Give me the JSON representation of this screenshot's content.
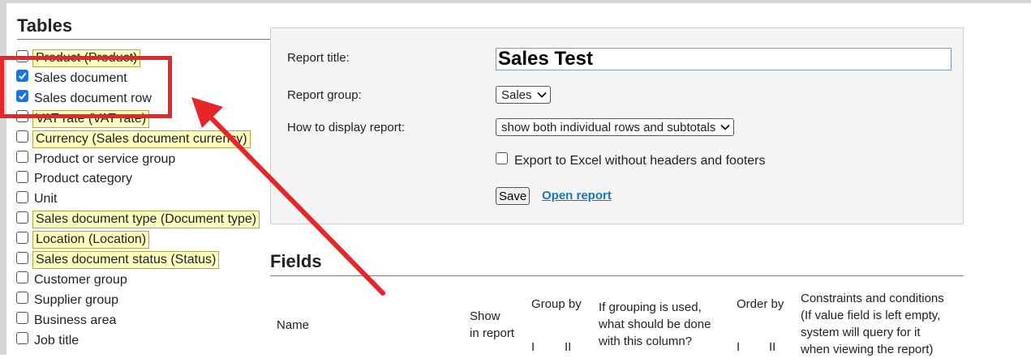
{
  "tables": {
    "heading": "Tables",
    "items": [
      {
        "label": "Product (Product)",
        "checked": false,
        "highlighted": true
      },
      {
        "label": "Sales document",
        "checked": true,
        "highlighted": false
      },
      {
        "label": "Sales document row",
        "checked": true,
        "highlighted": false
      },
      {
        "label": "VAT rate (VAT rate)",
        "checked": false,
        "highlighted": true
      },
      {
        "label": "Currency (Sales document currency)",
        "checked": false,
        "highlighted": true
      },
      {
        "label": "Product or service group",
        "checked": false,
        "highlighted": false
      },
      {
        "label": "Product category",
        "checked": false,
        "highlighted": false
      },
      {
        "label": "Unit",
        "checked": false,
        "highlighted": false
      },
      {
        "label": "Sales document type (Document type)",
        "checked": false,
        "highlighted": true
      },
      {
        "label": "Location (Location)",
        "checked": false,
        "highlighted": true
      },
      {
        "label": "Sales document status (Status)",
        "checked": false,
        "highlighted": true
      },
      {
        "label": "Customer group",
        "checked": false,
        "highlighted": false
      },
      {
        "label": "Supplier group",
        "checked": false,
        "highlighted": false
      },
      {
        "label": "Business area",
        "checked": false,
        "highlighted": false
      },
      {
        "label": "Job title",
        "checked": false,
        "highlighted": false
      }
    ]
  },
  "form": {
    "report_title_label": "Report title:",
    "report_title_value": "Sales Test",
    "report_group_label": "Report group:",
    "report_group_value": "Sales",
    "display_label": "How to display report:",
    "display_value": "show both individual rows and subtotals",
    "export_label": "Export to Excel without headers and footers",
    "export_checked": false,
    "save_label": "Save",
    "open_report_label": "Open report"
  },
  "fields": {
    "heading": "Fields",
    "columns": {
      "name": "Name",
      "show_in_report": [
        "Show",
        "in report"
      ],
      "group_by": [
        "Group by",
        "I",
        "II"
      ],
      "if_grouping": [
        "If grouping is used,",
        "what should be done",
        "with this column?"
      ],
      "order_by": [
        "Order by",
        "I",
        "II"
      ],
      "constraints": [
        "Constraints and conditions",
        "(If value field is left empty,",
        "system will query for it",
        "when viewing the report)"
      ]
    }
  },
  "colors": {
    "highlight_bg": "#ffffc0",
    "checkbox_accent": "#1a73e8",
    "link": "#1677c4",
    "annotation_red": "#e8262a"
  }
}
